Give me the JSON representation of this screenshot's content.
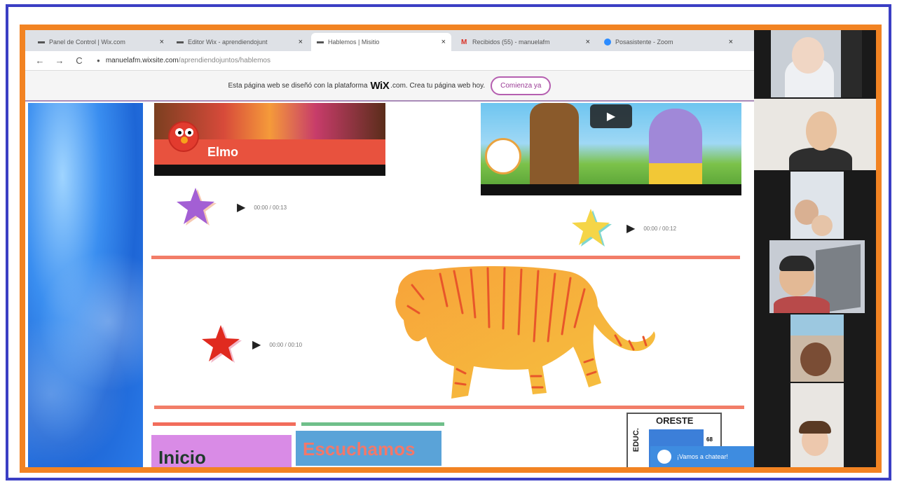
{
  "browser": {
    "tabs": [
      {
        "label": "Panel de Control | Wix.com",
        "icon": "wix-favicon",
        "active": false
      },
      {
        "label": "Editor Wix - aprendiendojunt",
        "icon": "wix-favicon",
        "active": false
      },
      {
        "label": "Hablemos | Misitio",
        "icon": "wix-favicon",
        "active": true
      },
      {
        "label": "Recibidos (55) - manuelafm",
        "icon": "gmail-icon",
        "active": false
      },
      {
        "label": "Posasistente - Zoom",
        "icon": "zoom-icon",
        "active": false
      }
    ],
    "tab_close": "×",
    "nav": {
      "back": "←",
      "forward": "→",
      "reload": "C"
    },
    "url_host": "manuelafm.wixsite.com",
    "url_path": "/aprendiendojuntos/hablemos",
    "wix_banner": {
      "text_before": "Esta página web se diseñó con la plataforma",
      "logo": "WiX",
      "text_after": ".com. Crea tu página web hoy.",
      "button": "Comienza ya"
    }
  },
  "page": {
    "elmo_label": "Elmo",
    "players": [
      {
        "time": "00:00 / 00:13",
        "star_color": "#a35fd4"
      },
      {
        "time": "00:00 / 00:12",
        "star_color": "#f5d547"
      },
      {
        "time": "00:00 / 00:10",
        "star_color": "#e02a1f"
      }
    ],
    "nav_boxes": [
      {
        "label": "Inicio",
        "color": "#d98be6",
        "text_color": "#1f3b2c",
        "line_color": "#f26d5b"
      },
      {
        "label": "Escuchamos",
        "color": "#5aa3d8",
        "text_color": "#f2786a",
        "line_color": "#6fbf8a"
      }
    ],
    "card": {
      "title": "ORESTE",
      "side": "EDUC.",
      "number": "68"
    },
    "chat": "¡Vamos a chatear!",
    "divider_color": "#f27d68"
  },
  "zoom": {
    "participants": 6
  }
}
